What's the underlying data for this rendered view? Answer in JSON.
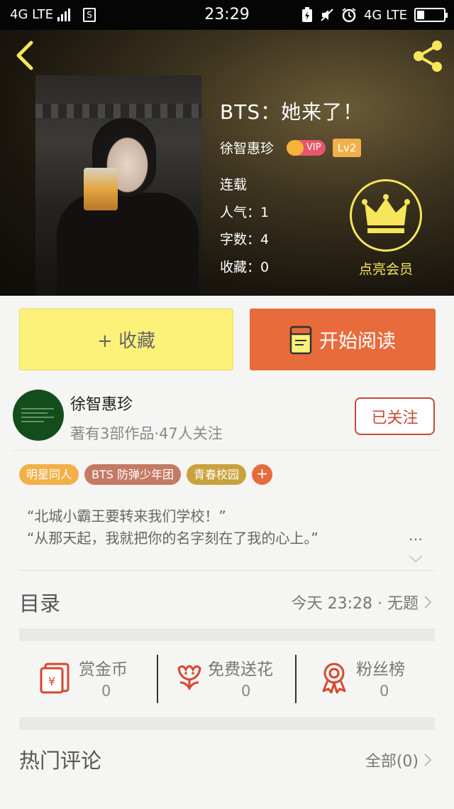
{
  "status_bar": {
    "network_left": "4G LTE",
    "sim_label": "S",
    "time": "23:29",
    "network_right": "4G LTE"
  },
  "book": {
    "title": "BTS：她来了！",
    "author": "徐智惠珍",
    "vip_label": "VIP",
    "level": "Lv2",
    "status": "连载",
    "popularity": "人气：1",
    "word_count": "字数：4",
    "favorites": "收藏：0"
  },
  "vip_promo": {
    "label": "点亮会员"
  },
  "actions": {
    "collect_label": "+ 收藏",
    "read_label": "开始阅读"
  },
  "author_card": {
    "name": "徐智惠珍",
    "meta": "著有3部作品·47人关注",
    "follow_label": "已关注"
  },
  "tags": [
    {
      "label": "明星同人",
      "color": "#f2b047"
    },
    {
      "label": "BTS  防弹少年团",
      "color": "#c47a63"
    },
    {
      "label": "青春校园",
      "color": "#c9a23e"
    }
  ],
  "tag_add_label": "+",
  "synopsis": {
    "line1": "“北城小霸王要转来我们学校！”",
    "line2": "“从那天起，我就把你的名字刻在了我的心上。”",
    "ellipsis": "…"
  },
  "toc": {
    "title": "目录",
    "latest": "今天 23:28 · 无题"
  },
  "gifts": [
    {
      "label": "赏金币",
      "count": "0",
      "icon": "red-envelope-icon"
    },
    {
      "label": "免费送花",
      "count": "0",
      "icon": "flower-icon"
    },
    {
      "label": "粉丝榜",
      "count": "0",
      "icon": "medal-icon"
    }
  ],
  "comments": {
    "title": "热门评论",
    "all_label": "全部(0)"
  },
  "colors": {
    "accent_orange": "#e86b3c",
    "collect_yellow": "#fcf27a",
    "follow_red": "#c74a3a",
    "vip_gold": "#f6e65a"
  }
}
